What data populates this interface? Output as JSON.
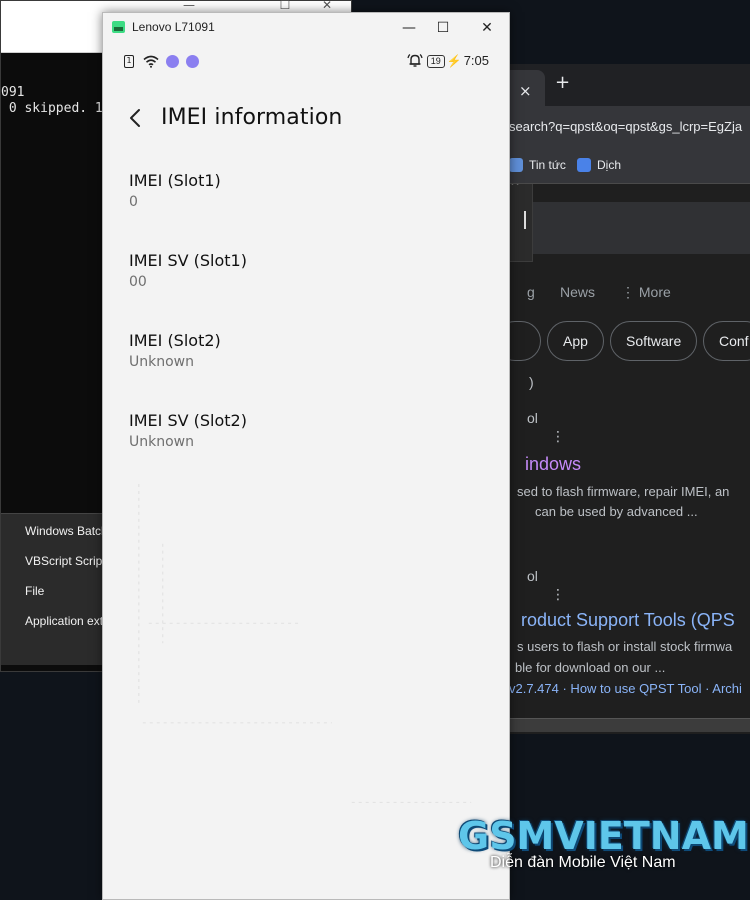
{
  "terminal": {
    "lines": [
      "091",
      " 0 skipped. 1"
    ],
    "context_menu": [
      "Windows Batch",
      "VBScript Script",
      "File",
      "Application ext"
    ]
  },
  "browser": {
    "tab_close": "×",
    "new_tab": "+",
    "url_fragment": "search?q=qpst&oq=qpst&gs_lcrp=EgZja",
    "bookmarks": [
      "Tin tức",
      "Dịch"
    ],
    "search_tabs": [
      "g",
      "News",
      "⋮ More"
    ],
    "chips": [
      "App",
      "Software",
      "Conf"
    ],
    "results": {
      "r0": ")",
      "r1_source": "ol",
      "r1_dots": "⋮",
      "r1_title": "indows",
      "r1_line1": "sed to flash firmware, repair IMEI, an",
      "r1_line2": "can be used by advanced ...",
      "r2_source": "ol",
      "r2_dots": "⋮",
      "r2_title": "roduct Support Tools (QPS",
      "r2_line1": "s users to flash or install stock firmwa",
      "r2_line2": "ble for download on our ...",
      "r2_links": "v2.7.474 · How to use QPST Tool · Archi"
    }
  },
  "phone_window": {
    "title": "Lenovo L71091",
    "controls": {
      "minimize": "—",
      "maximize": "☐",
      "close": "✕"
    },
    "status_bar": {
      "sim": "1",
      "battery": "19",
      "time": "7:05"
    },
    "page_title": "IMEI information",
    "items": [
      {
        "label": "IMEI (Slot1)",
        "value": "0"
      },
      {
        "label": "IMEI SV (Slot1)",
        "value": "00"
      },
      {
        "label": "IMEI (Slot2)",
        "value": "Unknown"
      },
      {
        "label": "IMEI SV (Slot2)",
        "value": "Unknown"
      }
    ]
  },
  "watermark": {
    "logo": "GSMVIETNAM",
    "tagline": "Diễn đàn Mobile Việt Nam"
  }
}
